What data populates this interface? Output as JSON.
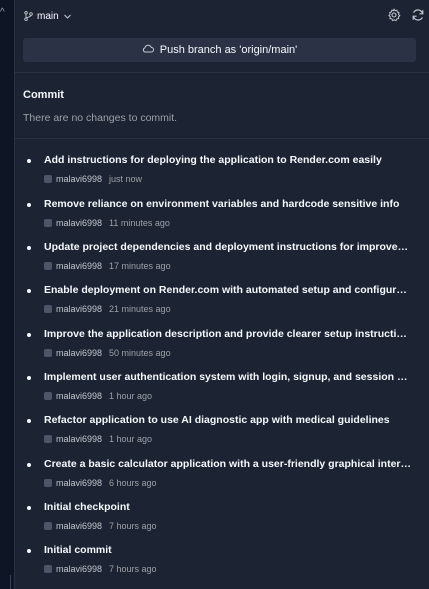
{
  "gutter": {
    "glyph": "^"
  },
  "toolbar": {
    "branch_label": "main",
    "branch_icon": "git-branch-icon",
    "settings_icon": "gear-icon",
    "refresh_icon": "refresh-icon"
  },
  "push": {
    "label": "Push branch as 'origin/main'",
    "icon": "cloud-icon"
  },
  "commit": {
    "title": "Commit",
    "empty_text": "There are no changes to commit."
  },
  "history": [
    {
      "message": "Add instructions for deploying the application to Render.com easily",
      "author": "malavi6998",
      "time": "just now"
    },
    {
      "message": "Remove reliance on environment variables and hardcode sensitive info",
      "author": "malavi6998",
      "time": "11 minutes ago"
    },
    {
      "message": "Update project dependencies and deployment instructions for improved se…",
      "author": "malavi6998",
      "time": "17 minutes ago"
    },
    {
      "message": "Enable deployment on Render.com with automated setup and configuration",
      "author": "malavi6998",
      "time": "21 minutes ago"
    },
    {
      "message": "Improve the application description and provide clearer setup instructions",
      "author": "malavi6998",
      "time": "50 minutes ago"
    },
    {
      "message": "Implement user authentication system with login, signup, and session man…",
      "author": "malavi6998",
      "time": "1 hour ago"
    },
    {
      "message": "Refactor application to use AI diagnostic app with medical guidelines",
      "author": "malavi6998",
      "time": "1 hour ago"
    },
    {
      "message": "Create a basic calculator application with a user-friendly graphical interface",
      "author": "malavi6998",
      "time": "6 hours ago"
    },
    {
      "message": "Initial checkpoint",
      "author": "malavi6998",
      "time": "7 hours ago"
    },
    {
      "message": "Initial commit",
      "author": "malavi6998",
      "time": "7 hours ago"
    }
  ],
  "colors": {
    "background": "#0e1525",
    "panel": "#1c2333",
    "button": "#2b3245",
    "text": "#f5f9fc",
    "muted": "#9da2a6"
  }
}
